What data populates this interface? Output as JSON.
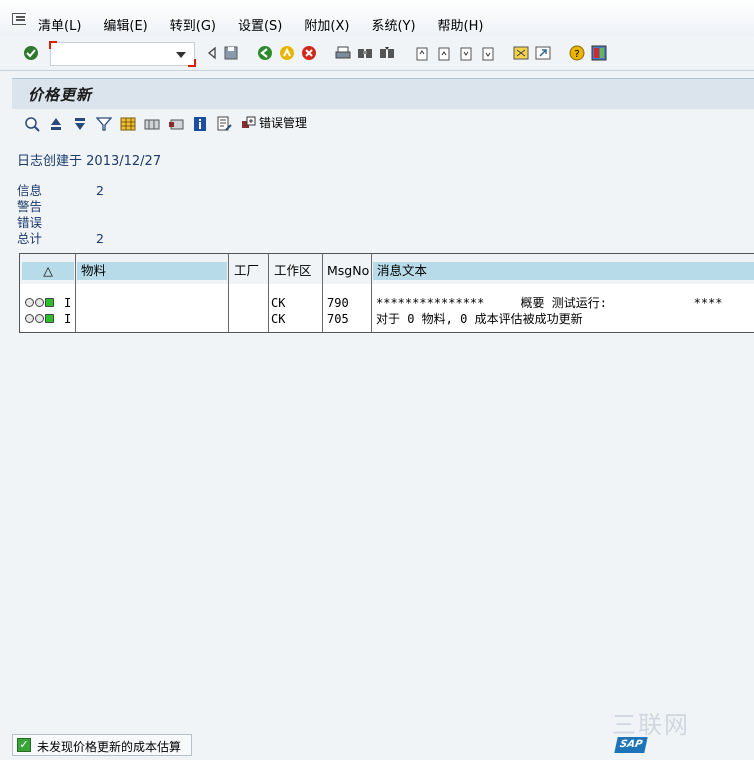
{
  "menu": {
    "items": [
      "清单(L)",
      "编辑(E)",
      "转到(G)",
      "设置(S)",
      "附加(X)",
      "系统(Y)",
      "帮助(H)"
    ]
  },
  "command_field": {
    "value": ""
  },
  "title": "价格更新",
  "app_toolbar": {
    "error_management_label": "错误管理"
  },
  "log": {
    "created_label": "日志创建于",
    "created_date": "2013/12/27",
    "stats": [
      {
        "label": "信息",
        "value": "2"
      },
      {
        "label": "警告",
        "value": ""
      },
      {
        "label": "错误",
        "value": ""
      },
      {
        "label": "总计",
        "value": "2"
      }
    ]
  },
  "table": {
    "columns": [
      "△",
      "物料",
      "工厂",
      "工作区",
      "MsgNo",
      "消息文本"
    ],
    "rows": [
      {
        "type": "I",
        "material": "",
        "plant": "",
        "area": "CK",
        "msgno": "790",
        "text": "***************     概要 测试运行:            ****"
      },
      {
        "type": "I",
        "material": "",
        "plant": "",
        "area": "CK",
        "msgno": "705",
        "text": "对于 0 物料, 0 成本评估被成功更新"
      }
    ]
  },
  "status": {
    "message": "未发现价格更新的成本估算",
    "logo": "SAP",
    "watermark": "三联网"
  },
  "colors": {
    "background": "#f1f4f7",
    "header_cell": "#b7dbe8",
    "title_bar": "#dbe4ec",
    "status_green": "#3aa33a"
  }
}
